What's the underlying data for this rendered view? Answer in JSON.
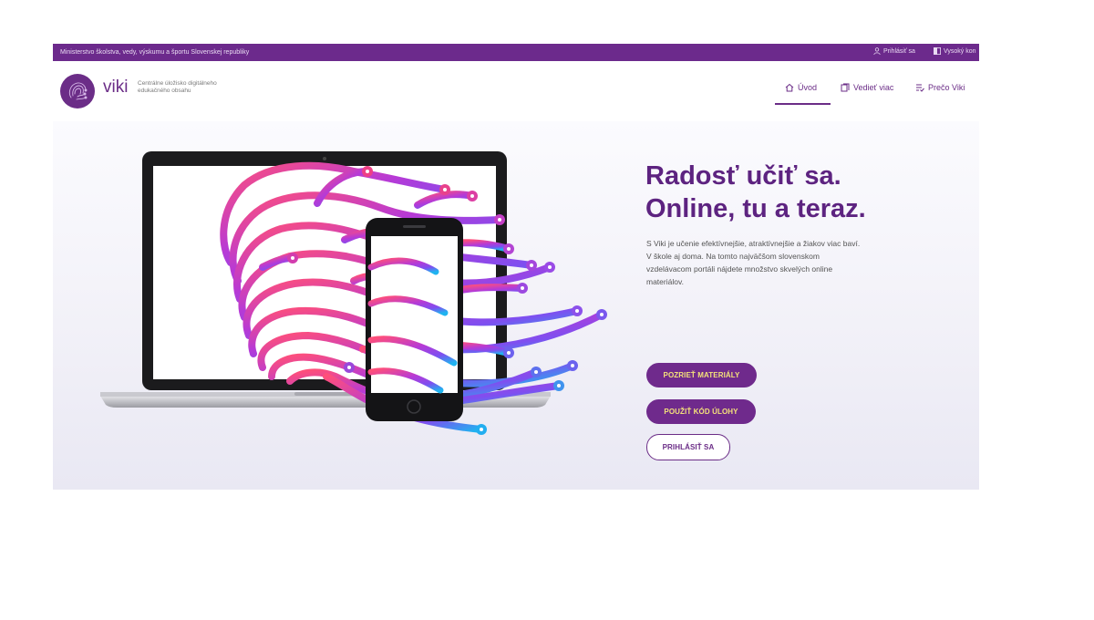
{
  "topbar": {
    "ministry": "Ministerstvo školstva, vedy, výskumu a športu Slovenskej republiky",
    "login": "Prihlásiť sa",
    "contrast": "Vysoký kon"
  },
  "brand": {
    "name": "viki",
    "subtitle": "Centrálne úložisko digitálneho edukačného obsahu"
  },
  "nav": {
    "items": [
      {
        "label": "Úvod",
        "icon": "home-icon",
        "active": true
      },
      {
        "label": "Vedieť viac",
        "icon": "book-icon",
        "active": false
      },
      {
        "label": "Prečo Viki",
        "icon": "checklist-icon",
        "active": false
      }
    ]
  },
  "hero": {
    "title_line1": "Radosť učiť sa.",
    "title_line2": "Online, tu a teraz.",
    "text": "S Viki je učenie efektívnejšie, atraktívnejšie a žiakov viac baví. V škole aj doma. Na tomto najväčšom slovenskom vzdelávacom portáli nájdete množstvo skvelých online materiálov.",
    "buttons": {
      "materials": "POZRIEŤ MATERIÁLY",
      "task_code": "POUŽIŤ KÓD ÚLOHY",
      "login": "PRIHLÁSIŤ SA"
    }
  },
  "colors": {
    "brand": "#6b2d87",
    "button_text": "#f4e27a",
    "gradient_start": "#ff4f7a",
    "gradient_end": "#1fb4f0"
  }
}
